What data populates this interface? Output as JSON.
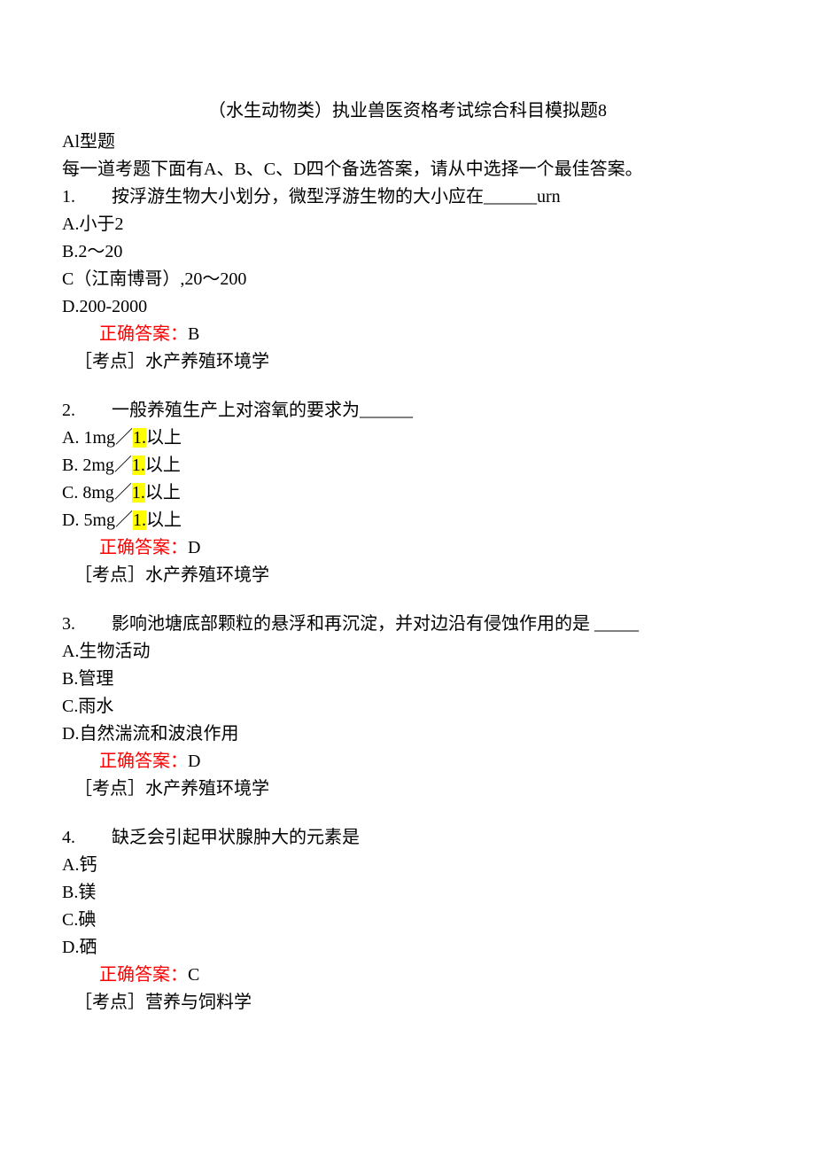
{
  "title": "（水生动物类）执业兽医资格考试综合科目模拟题8",
  "section_header": "Al型题",
  "instructions": "每一道考题下面有A、B、C、D四个备选答案，请从中选择一个最佳答案。",
  "answer_label": "正确答案：",
  "topic_label": "［考点］",
  "questions": [
    {
      "num": "1.",
      "text": "按浮游生物大小划分，微型浮游生物的大小应在______urn",
      "options": [
        {
          "label": "A.",
          "text": "小于2"
        },
        {
          "label": "B.",
          "text": "2～20"
        },
        {
          "label": "C",
          "text": "（江南博哥）,20～200"
        },
        {
          "label": "D.",
          "text": "200-2000"
        }
      ],
      "answer": "B",
      "topic": "水产养殖环境学"
    },
    {
      "num": "2.",
      "text": "一般养殖生产上对溶氧的要求为______",
      "options": [
        {
          "label": "A.",
          "text": "1mg／",
          "hl": "1.",
          "after": "以上",
          "pad": true
        },
        {
          "label": "B.",
          "text": "2mg／",
          "hl": "1.",
          "after": "以上",
          "pad": true
        },
        {
          "label": "C.",
          "text": "8mg／",
          "hl": "1.",
          "after": "以上",
          "pad": true
        },
        {
          "label": "D.",
          "text": "5mg／",
          "hl": "1.",
          "after": "以上",
          "pad": true
        }
      ],
      "answer": "D",
      "topic": "水产养殖环境学"
    },
    {
      "num": "3.",
      "text": "影响池塘底部颗粒的悬浮和再沉淀，并对边沿有侵蚀作用的是 _____",
      "options": [
        {
          "label": "A.",
          "text": "生物活动"
        },
        {
          "label": "B.",
          "text": "管理"
        },
        {
          "label": "C.",
          "text": "雨水"
        },
        {
          "label": "D.",
          "text": "自然湍流和波浪作用"
        }
      ],
      "answer": "D",
      "topic": "水产养殖环境学"
    },
    {
      "num": "4.",
      "text": "缺乏会引起甲状腺肿大的元素是",
      "options": [
        {
          "label": "A.",
          "text": "钙"
        },
        {
          "label": "B.",
          "text": "镁"
        },
        {
          "label": "C.",
          "text": "碘"
        },
        {
          "label": "D.",
          "text": "硒"
        }
      ],
      "answer": "C",
      "topic": "营养与饲料学"
    }
  ]
}
